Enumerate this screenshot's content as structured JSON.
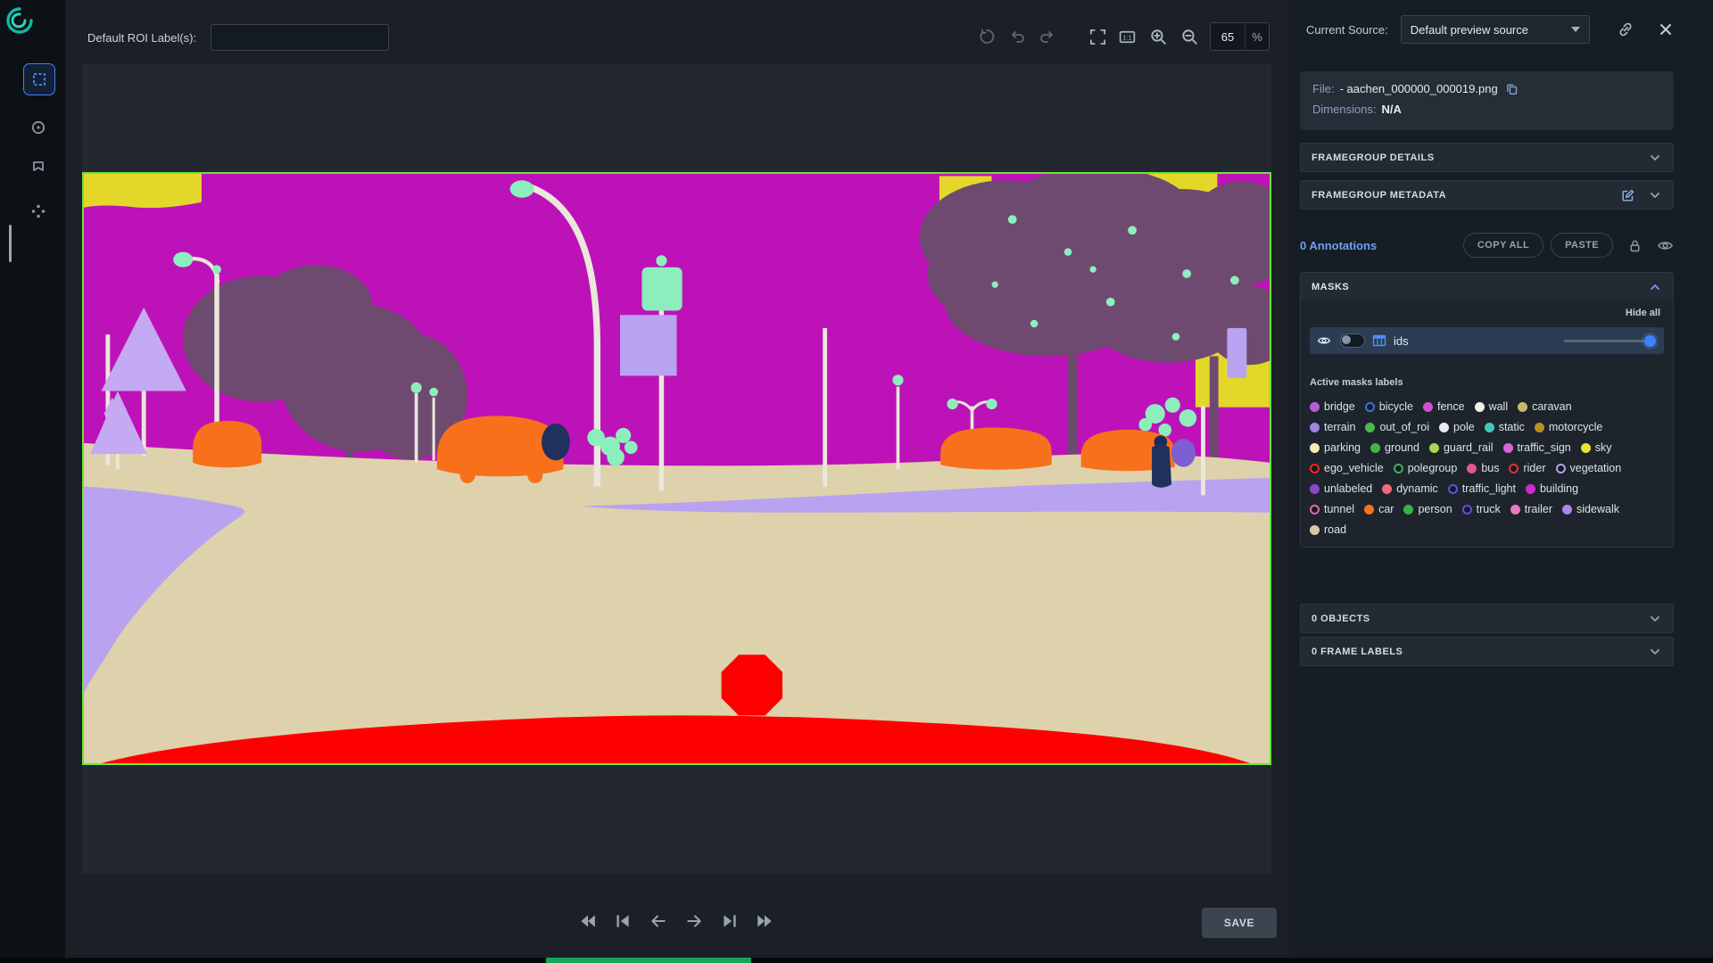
{
  "toolbar": {
    "roi_label": "Default ROI Label(s):",
    "zoom_value": "65",
    "zoom_unit": "%"
  },
  "source": {
    "label": "Current Source:",
    "selected": "Default preview source"
  },
  "file_info": {
    "file_label": "File:",
    "file_name": "- aachen_000000_000019.png",
    "dimensions_label": "Dimensions:",
    "dimensions_value": "N/A"
  },
  "sections": {
    "framegroup_details": "FRAMEGROUP DETAILS",
    "framegroup_metadata": "FRAMEGROUP METADATA",
    "objects": "0 OBJECTS",
    "frame_labels": "0 FRAME LABELS"
  },
  "annotations": {
    "count": "0 Annotations",
    "copy_all": "COPY ALL",
    "paste": "PASTE"
  },
  "masks": {
    "title": "MASKS",
    "hide_all": "Hide all",
    "layer": "ids",
    "active_title": "Active masks labels",
    "labels": [
      {
        "name": "bridge",
        "color": "#b65cd6",
        "style": "filled"
      },
      {
        "name": "bicycle",
        "color": "#3b6fe0",
        "style": "outline"
      },
      {
        "name": "fence",
        "color": "#d14ed1",
        "style": "filled"
      },
      {
        "name": "wall",
        "color": "#f2f2ea",
        "style": "filled"
      },
      {
        "name": "caravan",
        "color": "#c9b96e",
        "style": "filled"
      },
      {
        "name": "terrain",
        "color": "#9b85e0",
        "style": "filled"
      },
      {
        "name": "out_of_roi",
        "color": "#4db84d",
        "style": "filled"
      },
      {
        "name": "pole",
        "color": "#e9ecf2",
        "style": "filled"
      },
      {
        "name": "static",
        "color": "#3fc9b4",
        "style": "filled"
      },
      {
        "name": "motorcycle",
        "color": "#b8901f",
        "style": "filled"
      },
      {
        "name": "parking",
        "color": "#f2ecae",
        "style": "filled"
      },
      {
        "name": "ground",
        "color": "#49b049",
        "style": "filled"
      },
      {
        "name": "guard_rail",
        "color": "#a8d84f",
        "style": "filled"
      },
      {
        "name": "traffic_sign",
        "color": "#d966d9",
        "style": "filled"
      },
      {
        "name": "sky",
        "color": "#e8e233",
        "style": "filled"
      },
      {
        "name": "ego_vehicle",
        "color": "#f3261c",
        "style": "outline"
      },
      {
        "name": "polegroup",
        "color": "#3fae5c",
        "style": "outline"
      },
      {
        "name": "bus",
        "color": "#e0559a",
        "style": "filled"
      },
      {
        "name": "rider",
        "color": "#e23333",
        "style": "outline"
      },
      {
        "name": "vegetation",
        "color": "#b3a3ea",
        "style": "outline"
      },
      {
        "name": "unlabeled",
        "color": "#8d46c9",
        "style": "filled"
      },
      {
        "name": "dynamic",
        "color": "#ef6a7d",
        "style": "filled"
      },
      {
        "name": "traffic_light",
        "color": "#5e52e8",
        "style": "outline"
      },
      {
        "name": "building",
        "color": "#c92ec9",
        "style": "filled"
      },
      {
        "name": "tunnel",
        "color": "#ea67b1",
        "style": "outline"
      },
      {
        "name": "car",
        "color": "#f4731d",
        "style": "filled"
      },
      {
        "name": "person",
        "color": "#38b24a",
        "style": "filled"
      },
      {
        "name": "truck",
        "color": "#6a4ae0",
        "style": "outline"
      },
      {
        "name": "trailer",
        "color": "#ea79c1",
        "style": "filled"
      },
      {
        "name": "sidewalk",
        "color": "#b184e8",
        "style": "filled"
      },
      {
        "name": "road",
        "color": "#d8cba3",
        "style": "filled"
      }
    ]
  },
  "footer": {
    "save": "SAVE"
  }
}
